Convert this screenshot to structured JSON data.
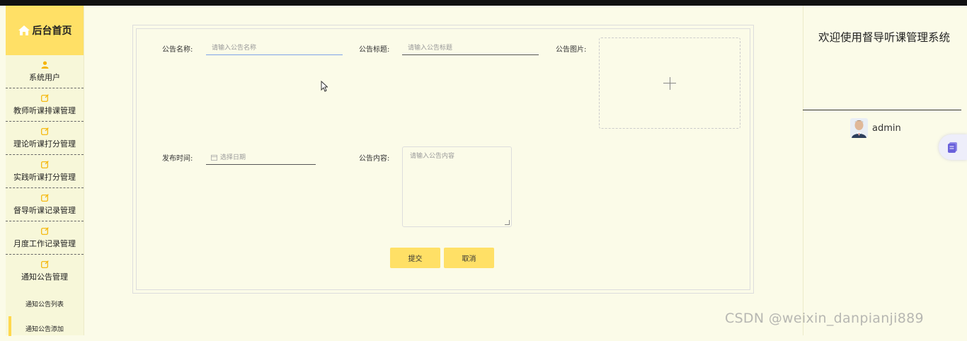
{
  "sidebar": {
    "home_label": "后台首页",
    "items": [
      {
        "label": "系统用户",
        "icon": "user-icon"
      },
      {
        "label": "教师听课排课管理",
        "icon": "edit-icon"
      },
      {
        "label": "理论听课打分管理",
        "icon": "edit-icon"
      },
      {
        "label": "实践听课打分管理",
        "icon": "edit-icon"
      },
      {
        "label": "督导听课记录管理",
        "icon": "edit-icon"
      },
      {
        "label": "月度工作记录管理",
        "icon": "edit-icon"
      },
      {
        "label": "通知公告管理",
        "icon": "edit-icon"
      }
    ],
    "subitems": [
      {
        "label": "通知公告列表"
      },
      {
        "label": "通知公告添加"
      }
    ]
  },
  "form": {
    "name_label": "公告名称:",
    "name_placeholder": "请输入公告名称",
    "title_label": "公告标题:",
    "title_placeholder": "请输入公告标题",
    "image_label": "公告图片:",
    "time_label": "发布时间:",
    "time_placeholder": "选择日期",
    "content_label": "公告内容:",
    "content_placeholder": "请输入公告内容",
    "submit_label": "提交",
    "cancel_label": "取消"
  },
  "header": {
    "welcome": "欢迎使用督导听课管理系统",
    "username": "admin"
  },
  "watermark": "CSDN @weixin_danpianji889",
  "colors": {
    "accent": "#ffe066",
    "background": "#fbfbe8",
    "sidebar_bg": "#f7f7d9",
    "icon_orange": "#f5b400"
  }
}
